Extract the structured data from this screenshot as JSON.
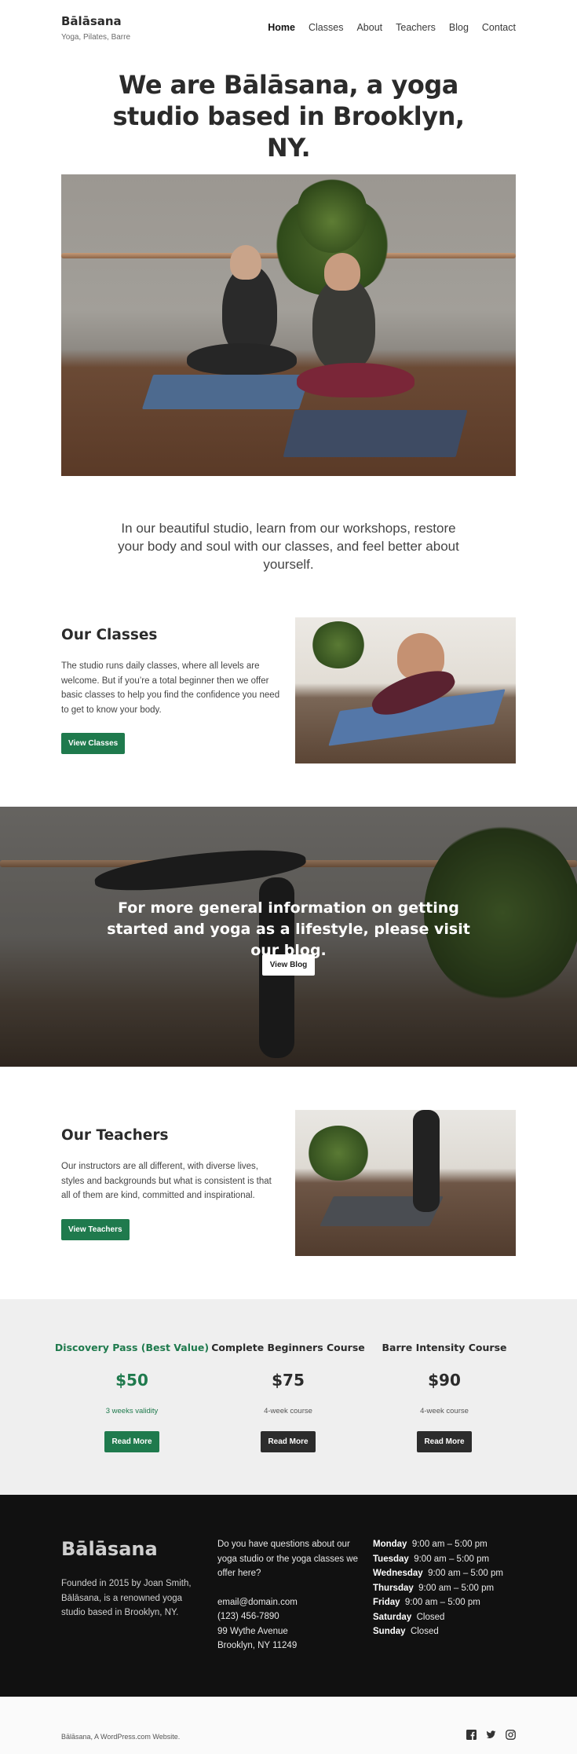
{
  "header": {
    "site_title": "Bālāsana",
    "tagline": "Yoga, Pilates, Barre",
    "nav": [
      "Home",
      "Classes",
      "About",
      "Teachers",
      "Blog",
      "Contact"
    ]
  },
  "hero": {
    "title": "We are Bālāsana, a yoga studio based in Brooklyn, NY."
  },
  "intro": {
    "text": "In our beautiful studio, learn from our workshops, restore your body and soul with our classes, and feel better about yourself."
  },
  "classes": {
    "title": "Our Classes",
    "text": "The studio runs daily classes, where all levels are welcome. But if you’re a total beginner then we offer basic classes to help you find the confidence you need to get to know your body.",
    "button": "View Classes"
  },
  "blog": {
    "text": "For more general information on getting started and yoga as a lifestyle, please visit our blog.",
    "button": "View Blog"
  },
  "teachers": {
    "title": "Our Teachers",
    "text": "Our instructors are all different, with diverse lives, styles and backgrounds but what is consistent is that all of them are kind, committed and inspirational.",
    "button": "View Teachers"
  },
  "pricing": [
    {
      "name": "Discovery Pass (Best Value)",
      "price": "$50",
      "note": "3 weeks validity",
      "button": "Read More"
    },
    {
      "name": "Complete Beginners Course",
      "price": "$75",
      "note": "4-week course",
      "button": "Read More"
    },
    {
      "name": "Barre Intensity Course",
      "price": "$90",
      "note": "4-week course",
      "button": "Read More"
    }
  ],
  "footer": {
    "brand": "Bālāsana",
    "about": "Founded in 2015 by Joan Smith, Bālāsana, is a renowned yoga studio based in Brooklyn, NY.",
    "contact_question": "Do you have questions about our yoga studio or the yoga classes we offer here?",
    "email": "email@domain.com",
    "phone": "(123) 456-7890",
    "address_line1": "99 Wythe Avenue",
    "address_line2": "Brooklyn, NY 11249",
    "hours": [
      {
        "day": "Monday",
        "time": "9:00 am – 5:00 pm"
      },
      {
        "day": "Tuesday",
        "time": "9:00 am – 5:00 pm"
      },
      {
        "day": "Wednesday",
        "time": "9:00 am – 5:00 pm"
      },
      {
        "day": "Thursday",
        "time": "9:00 am – 5:00 pm"
      },
      {
        "day": "Friday",
        "time": "9:00 am – 5:00 pm"
      },
      {
        "day": "Saturday",
        "time": "Closed"
      },
      {
        "day": "Sunday",
        "time": "Closed"
      }
    ]
  },
  "bottom": {
    "credit": "Bālāsana, A WordPress.com Website.",
    "social_icons": [
      "facebook-icon",
      "twitter-icon",
      "instagram-icon"
    ]
  },
  "colors": {
    "accent": "#1f7a4d",
    "dark_button": "#2c2c2c",
    "footer_bg": "#111111",
    "pricing_bg": "#efefef"
  }
}
